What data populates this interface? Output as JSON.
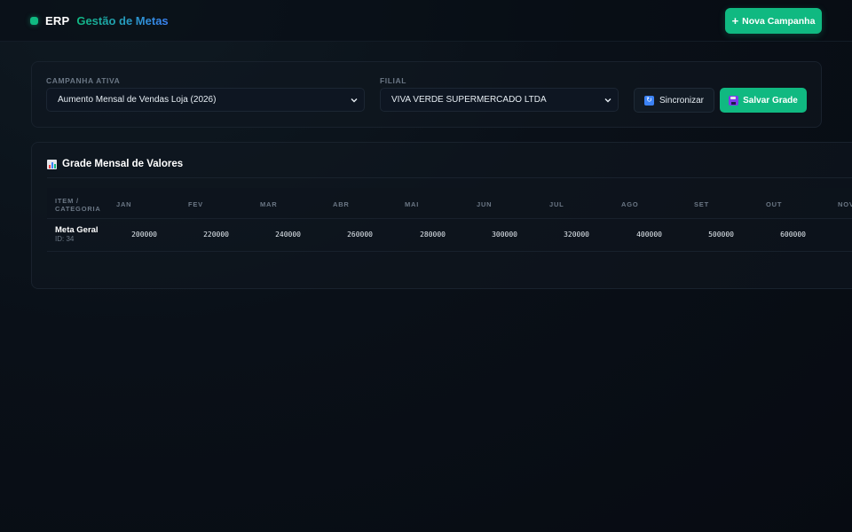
{
  "header": {
    "brand": "ERP",
    "title": "Gestão de Metas",
    "new_campaign_label": "Nova Campanha"
  },
  "filters": {
    "campaign_label": "CAMPANHA ATIVA",
    "campaign_value": "Aumento Mensal de Vendas Loja (2026)",
    "branch_label": "FILIAL",
    "branch_value": "VIVA VERDE SUPERMERCADO LTDA",
    "sync_label": "Sincronizar",
    "save_label": "Salvar Grade"
  },
  "grid": {
    "title": "Grade Mensal de Valores",
    "item_header": "ITEM / CATEGORIA",
    "months": [
      "JAN",
      "FEV",
      "MAR",
      "ABR",
      "MAI",
      "JUN",
      "JUL",
      "AGO",
      "SET",
      "OUT",
      "NOV"
    ],
    "rows": [
      {
        "name": "Meta Geral",
        "id": "ID: 34",
        "values": [
          "200000",
          "220000",
          "240000",
          "260000",
          "280000",
          "300000",
          "320000",
          "400000",
          "500000",
          "600000"
        ]
      }
    ]
  },
  "colors": {
    "accent": "#10b981",
    "title_gradient_end": "#3b82f6",
    "background": "#0a1018"
  },
  "icons": {
    "brand": "status-dot-icon",
    "new_campaign": "plus-icon",
    "sync": "sync-icon",
    "save": "floppy-disk-icon",
    "grid_title": "bar-chart-icon",
    "select": "chevron-down-icon"
  }
}
